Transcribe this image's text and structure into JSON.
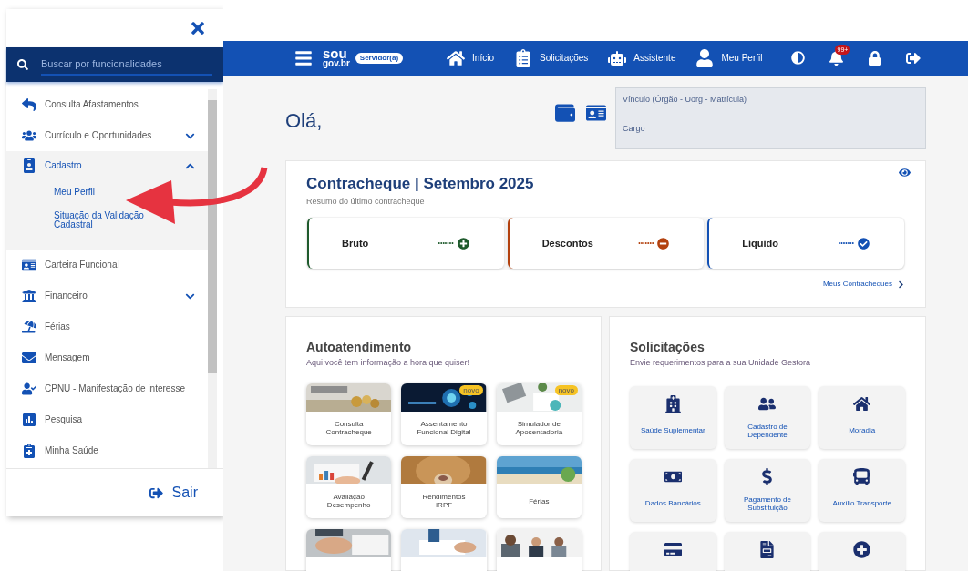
{
  "drawer": {
    "search": {
      "placeholder": "Buscar por funcionalidades"
    },
    "menu": [
      {
        "kind": "link",
        "label": "Consulta Afastamentos"
      },
      {
        "kind": "group",
        "label": "Currículo e Oportunidades",
        "expanded": false
      },
      {
        "kind": "group",
        "label": "Cadastro",
        "expanded": true,
        "children": [
          {
            "label": "Meu Perfil"
          },
          {
            "label": "Situação da Validação Cadastral"
          }
        ]
      },
      {
        "kind": "link",
        "label": "Carteira Funcional"
      },
      {
        "kind": "group",
        "label": "Financeiro",
        "expanded": false
      },
      {
        "kind": "link",
        "label": "Férias"
      },
      {
        "kind": "link",
        "label": "Mensagem"
      },
      {
        "kind": "link",
        "label": "CPNU - Manifestação de interesse"
      },
      {
        "kind": "link",
        "label": "Pesquisa"
      },
      {
        "kind": "link",
        "label": "Minha Saúde"
      }
    ],
    "logout": "Sair"
  },
  "header": {
    "logo": [
      "sou",
      "gov.br"
    ],
    "role_badge": "Servidor(a)",
    "nav": [
      {
        "label": "Início"
      },
      {
        "label": "Solicitações"
      },
      {
        "label": "Assistente"
      },
      {
        "label": "Meu Perfil"
      }
    ],
    "notifications": "99+"
  },
  "greeting": "Olá,",
  "profile_box": {
    "line1": "Vínculo (Órgão - Uorg - Matrícula)",
    "line2": "Cargo"
  },
  "payslip": {
    "title": "Contracheque | Setembro 2025",
    "subtitle": "Resumo do último contracheque",
    "items": [
      {
        "label": "Bruto",
        "value": "•••••••",
        "color": "#1e5a2c"
      },
      {
        "label": "Descontos",
        "value": "•••••••",
        "color": "#b3410e"
      },
      {
        "label": "Líquido",
        "value": "•••••••",
        "color": "#1351b4"
      }
    ],
    "link": "Meus Contracheques"
  },
  "self_service": {
    "title": "Autoatendimento",
    "subtitle": "Aqui você tem informação a hora que quiser!",
    "tiles": [
      {
        "kind": "labeled",
        "label": "Consulta Contracheque"
      },
      {
        "kind": "labeled",
        "label": "Assentamento Funcional Digital",
        "badge": "novo"
      },
      {
        "kind": "labeled",
        "label": "Simulador de Aposentadoria",
        "badge": "novo"
      },
      {
        "kind": "labeled",
        "label": "Avaliação Desempenho"
      },
      {
        "kind": "labeled",
        "label": "Rendimentos IRPF"
      },
      {
        "kind": "labeled",
        "label": "Férias"
      },
      {
        "kind": "picture"
      },
      {
        "kind": "picture"
      },
      {
        "kind": "picture"
      }
    ]
  },
  "requests": {
    "title": "Solicitações",
    "subtitle": "Envie requerimentos para a sua Unidade Gestora",
    "tiles": [
      {
        "kind": "labeled",
        "label": "Saúde Suplementar"
      },
      {
        "kind": "labeled",
        "label": "Cadastro de Dependente"
      },
      {
        "kind": "labeled",
        "label": "Moradia"
      },
      {
        "kind": "labeled",
        "label": "Dados Bancários"
      },
      {
        "kind": "labeled",
        "label": "Pagamento de Substituição"
      },
      {
        "kind": "labeled",
        "label": "Auxílio Transporte"
      },
      {
        "kind": "icon"
      },
      {
        "kind": "icon"
      },
      {
        "kind": "icon"
      }
    ]
  }
}
